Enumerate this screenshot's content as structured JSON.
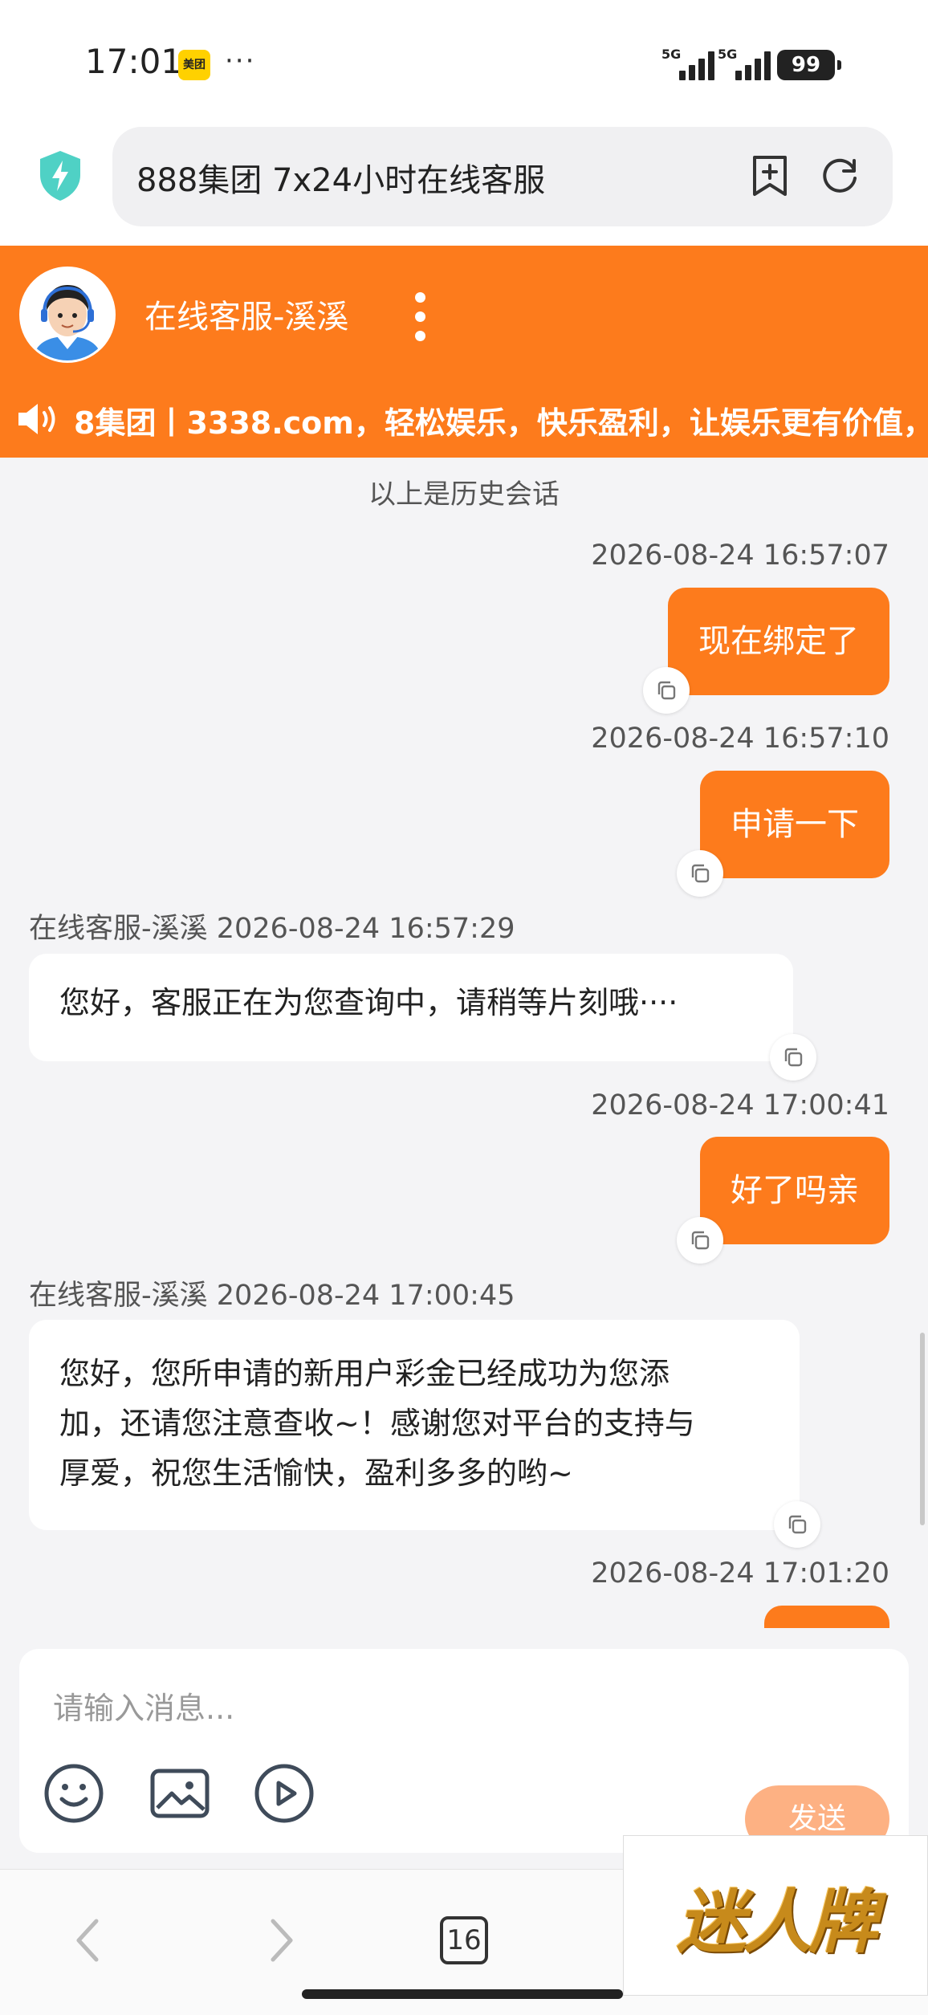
{
  "status_bar": {
    "time": "17:01",
    "app_badge": "美团",
    "overflow": "···",
    "signal_1": "5G",
    "signal_2": "5G",
    "battery": "99"
  },
  "browser": {
    "url_title": "888集团 7x24小时在线客服"
  },
  "header": {
    "agent_name": "在线客服-溪溪"
  },
  "marquee": {
    "text": "8集团丨3338.com，轻松娱乐，快乐盈利，让娱乐更有价值，"
  },
  "chat": {
    "history_label": "以上是历史会话",
    "messages": [
      {
        "from": "user",
        "timestamp": "2026-08-24 16:57:07",
        "text": "现在绑定了"
      },
      {
        "from": "user",
        "timestamp": "2026-08-24 16:57:10",
        "text": "申请一下"
      },
      {
        "from": "agent",
        "sender": "在线客服-溪溪",
        "timestamp": "2026-08-24 16:57:29",
        "text": "您好，客服正在为您查询中，请稍等片刻哦····"
      },
      {
        "from": "user",
        "timestamp": "2026-08-24 17:00:41",
        "text": "好了吗亲"
      },
      {
        "from": "agent",
        "sender": "在线客服-溪溪",
        "timestamp": "2026-08-24 17:00:45",
        "lines": [
          "您好，您所申请的新用户彩金已经成功为您添",
          "加，还请您注意查收~！感谢您对平台的支持与",
          "厚爱，祝您生活愉快，盈利多多的哟~"
        ]
      },
      {
        "from": "user",
        "timestamp": "2026-08-24 17:01:20"
      }
    ]
  },
  "composer": {
    "placeholder": "请输入消息...",
    "send_label": "发送"
  },
  "bottom_nav": {
    "tabs_count": "16"
  },
  "watermark": {
    "text": "迷人牌"
  },
  "colors": {
    "brand_orange": "#fd7b1c",
    "send_disabled": "#fdb183",
    "background": "#f4f4f6"
  }
}
